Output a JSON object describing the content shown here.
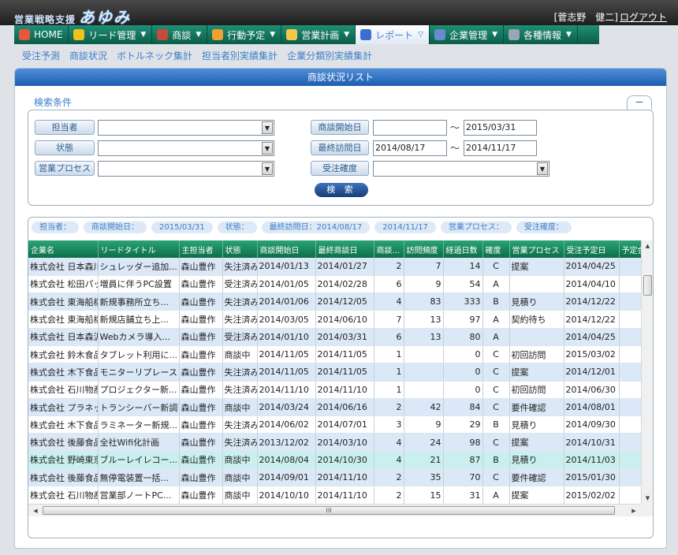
{
  "header": {
    "brand_sub": "営業戦略支援",
    "brand_main": "あゆみ",
    "user": "[菅志野　健二]",
    "logout": "ログアウト"
  },
  "nav": [
    {
      "label": "HOME",
      "icon": "home-icon",
      "color": "#e8563a"
    },
    {
      "label": "リード管理",
      "icon": "lead-icon",
      "color": "#f1c21b"
    },
    {
      "label": "商談",
      "icon": "negotiation-icon",
      "color": "#c74a3a"
    },
    {
      "label": "行動予定",
      "icon": "schedule-icon",
      "color": "#f0a030"
    },
    {
      "label": "営業計画",
      "icon": "plan-icon",
      "color": "#f5c84a"
    },
    {
      "label": "レポート",
      "icon": "report-icon",
      "color": "#3a6fd0"
    },
    {
      "label": "企業管理",
      "icon": "company-icon",
      "color": "#6a8ad0"
    },
    {
      "label": "各種情報",
      "icon": "info-icon",
      "color": "#9aa6b4"
    }
  ],
  "subnav": [
    "受注予測",
    "商談状況",
    "ボトルネック集計",
    "担当者別実績集計",
    "企業分類別実績集計"
  ],
  "panel_title": "商談状況リスト",
  "search": {
    "title": "検索条件",
    "collapse": "－",
    "labels": {
      "tanto": "担当者",
      "jotai": "状態",
      "process": "営業プロセス",
      "start": "商談開始日",
      "last": "最終訪問日",
      "kakudo": "受注確度"
    },
    "start_from": "",
    "start_to": "2015/03/31",
    "last_from": "2014/08/17",
    "last_to": "2014/11/17",
    "tilde": "～",
    "button": "検 索"
  },
  "chips": [
    "担当者：",
    "商談開始日：",
    "2015/03/31",
    "状態：",
    "最終訪問日：2014/08/17",
    "2014/11/17",
    "営業プロセス：",
    "受注確度："
  ],
  "table": {
    "headers": [
      "企業名",
      "リードタイトル",
      "主担当者",
      "状態",
      "商談開始日",
      "最終商談日",
      "商談...",
      "訪問頻度",
      "経過日数",
      "確度",
      "営業プロセス",
      "受注予定日",
      "予定金額"
    ],
    "rows": [
      [
        "株式会社 日本森川...",
        "シュレッダー追加...",
        "森山豊作",
        "失注済み",
        "2014/01/13",
        "2014/01/27",
        "2",
        "7",
        "14",
        "C",
        "提案",
        "2014/04/25",
        ""
      ],
      [
        "株式会社 松田パック",
        "増員に伴うPC設置",
        "森山豊作",
        "受注済み",
        "2014/01/05",
        "2014/02/28",
        "6",
        "9",
        "54",
        "A",
        "",
        "2014/04/10",
        ""
      ],
      [
        "株式会社 東海船橋...",
        "新規事務所立ち...",
        "森山豊作",
        "失注済み",
        "2014/01/06",
        "2014/12/05",
        "4",
        "83",
        "333",
        "B",
        "見積り",
        "2014/12/22",
        ""
      ],
      [
        "株式会社 東海船橋...",
        "新規店舗立ち上...",
        "森山豊作",
        "失注済み",
        "2014/03/05",
        "2014/06/10",
        "7",
        "13",
        "97",
        "A",
        "契約待ち",
        "2014/12/22",
        ""
      ],
      [
        "株式会社 日本森沢...",
        "Webカメラ導入...",
        "森山豊作",
        "受注済み",
        "2014/01/10",
        "2014/03/31",
        "6",
        "13",
        "80",
        "A",
        "",
        "2014/04/25",
        ""
      ],
      [
        "株式会社 鈴木食品",
        "タブレット利用に...",
        "森山豊作",
        "商談中",
        "2014/11/05",
        "2014/11/05",
        "1",
        "",
        "0",
        "C",
        "初回訪問",
        "2015/03/02",
        ""
      ],
      [
        "株式会社 木下食品",
        "モニターリプレース",
        "森山豊作",
        "失注済み",
        "2014/11/05",
        "2014/11/05",
        "1",
        "",
        "0",
        "C",
        "提案",
        "2014/12/01",
        ""
      ],
      [
        "株式会社 石川物産",
        "プロジェクター新...",
        "森山豊作",
        "失注済み",
        "2014/11/10",
        "2014/11/10",
        "1",
        "",
        "0",
        "C",
        "初回訪問",
        "2014/06/30",
        ""
      ],
      [
        "株式会社 プラネット...",
        "トランシーバー新調",
        "森山豊作",
        "商談中",
        "2014/03/24",
        "2014/06/16",
        "2",
        "42",
        "84",
        "C",
        "要件確認",
        "2014/08/01",
        ""
      ],
      [
        "株式会社 木下食品",
        "ラミネーター新規...",
        "森山豊作",
        "失注済み",
        "2014/06/02",
        "2014/07/01",
        "3",
        "9",
        "29",
        "B",
        "見積り",
        "2014/09/30",
        ""
      ],
      [
        "株式会社 後藤食品...",
        "全社Wifi化計画",
        "森山豊作",
        "失注済み",
        "2013/12/02",
        "2014/03/10",
        "4",
        "24",
        "98",
        "C",
        "提案",
        "2014/10/31",
        ""
      ],
      [
        "株式会社 野崎東京...",
        "ブルーレイレコー...",
        "森山豊作",
        "商談中",
        "2014/08/04",
        "2014/10/30",
        "4",
        "21",
        "87",
        "B",
        "見積り",
        "2014/11/03",
        ""
      ],
      [
        "株式会社 後藤食品...",
        "無停電装置一括...",
        "森山豊作",
        "商談中",
        "2014/09/01",
        "2014/11/10",
        "2",
        "35",
        "70",
        "C",
        "要件確認",
        "2015/01/30",
        ""
      ],
      [
        "株式会社 石川物産",
        "営業部ノートPC...",
        "森山豊作",
        "商談中",
        "2014/10/10",
        "2014/11/10",
        "2",
        "15",
        "31",
        "A",
        "提案",
        "2015/02/02",
        ""
      ]
    ],
    "highlight_row": 11
  },
  "scroll": {
    "h_grip": "III"
  }
}
